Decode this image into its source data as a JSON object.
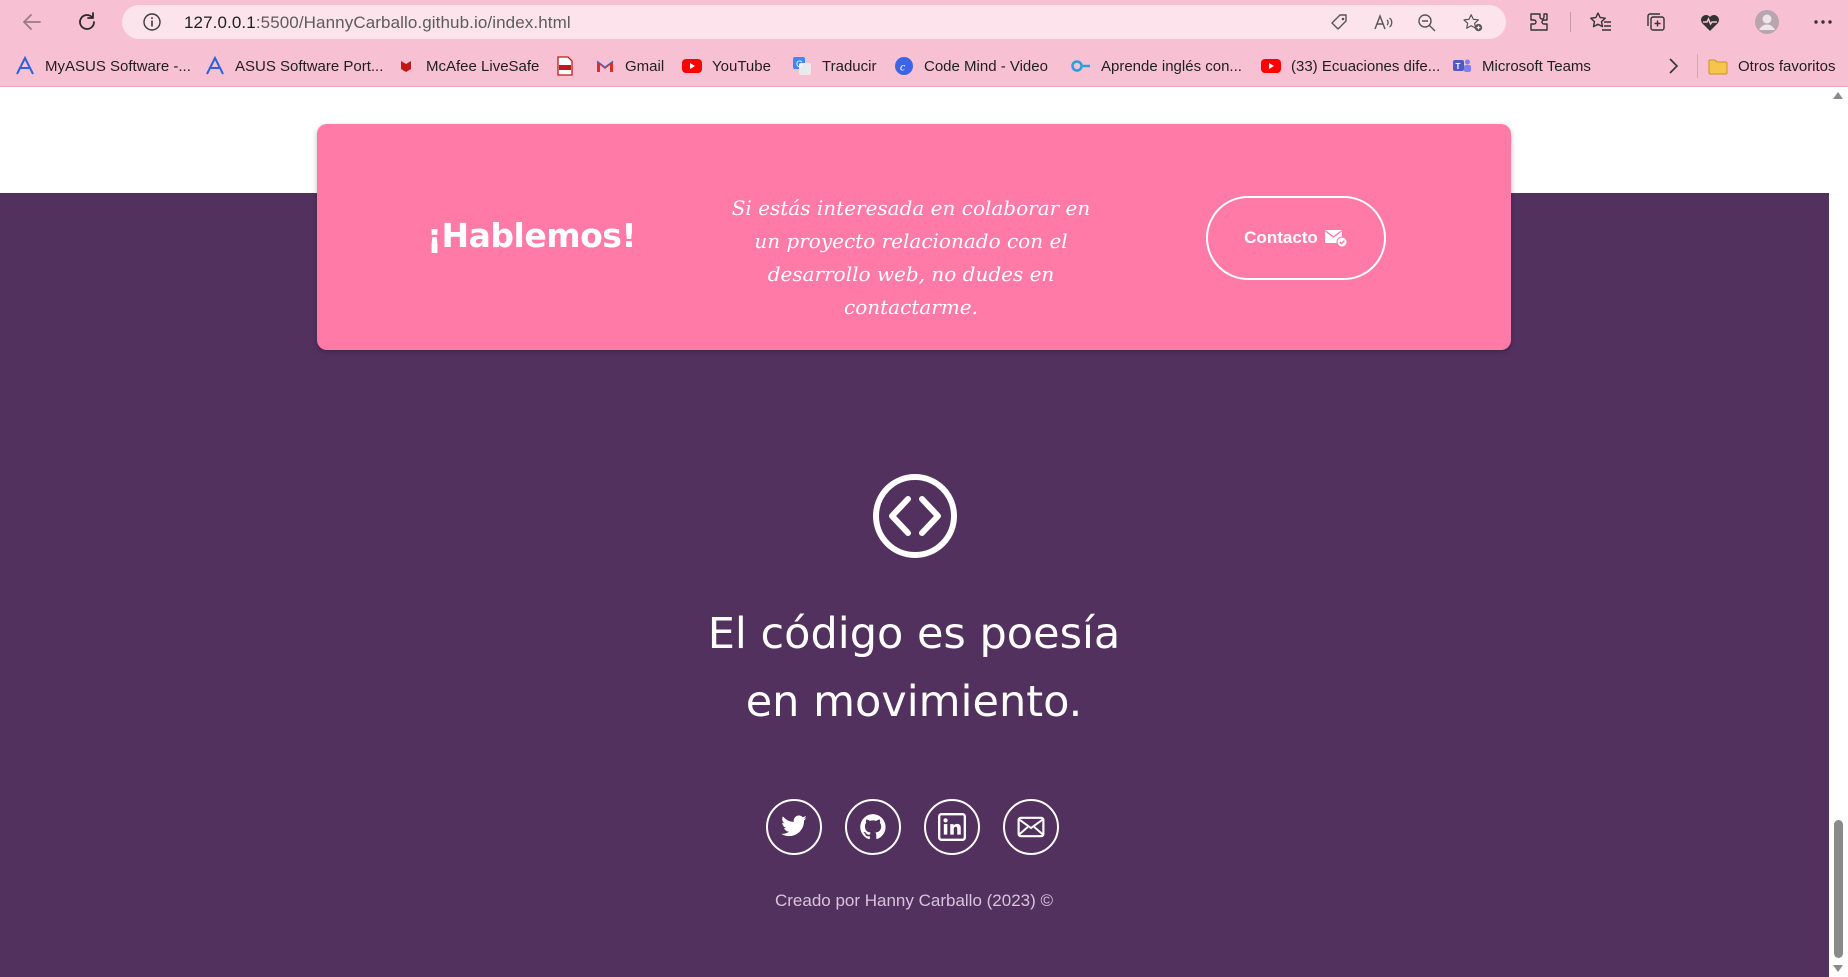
{
  "browser": {
    "url_host": "127.0.0.1",
    "url_rest": ":5500/HannyCarballo.github.io/index.html",
    "bookmarks": [
      {
        "label": "MyASUS Software -...",
        "icon": "asus-icon"
      },
      {
        "label": "ASUS Software Port...",
        "icon": "asus-icon"
      },
      {
        "label": "McAfee LiveSafe",
        "icon": "mcafee-icon"
      },
      {
        "label": "",
        "icon": "pdf-icon"
      },
      {
        "label": "Gmail",
        "icon": "gmail-icon"
      },
      {
        "label": "YouTube",
        "icon": "youtube-icon"
      },
      {
        "label": "Traducir",
        "icon": "translate-icon"
      },
      {
        "label": "Code Mind - Video",
        "icon": "codemind-icon"
      },
      {
        "label": "Aprende inglés con...",
        "icon": "link-icon"
      },
      {
        "label": "(33) Ecuaciones dife...",
        "icon": "youtube-icon"
      },
      {
        "label": "Microsoft Teams",
        "icon": "teams-icon"
      }
    ],
    "other_favorites": "Otros favoritos"
  },
  "cta": {
    "title": "¡Hablemos!",
    "text": "Si estás interesada en colaborar en un proyecto relacionado con el desarrollo web, no dudes en contactarme.",
    "button_label": "Contacto"
  },
  "footer": {
    "tagline_line1": "El código es poesía",
    "tagline_line2": "en movimiento.",
    "socials": [
      "twitter-icon",
      "github-icon",
      "linkedin-icon",
      "mail-icon"
    ],
    "credit": "Creado por Hanny Carballo (2023) ©"
  },
  "colors": {
    "browser_chrome": "#f8c0d3",
    "address_bar": "#fde3ec",
    "footer_bg": "#53315f",
    "cta_bg": "#ff7aa6",
    "text_light": "#ffffff"
  }
}
